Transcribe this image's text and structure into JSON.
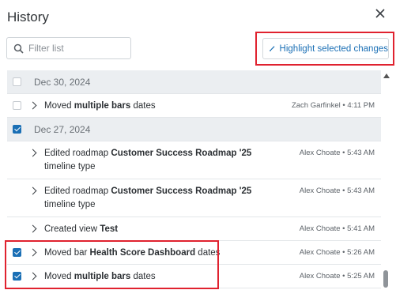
{
  "header": {
    "title": "History"
  },
  "filter": {
    "placeholder": "Filter list"
  },
  "highlight_button": {
    "label": "Highlight selected changes"
  },
  "groups": [
    {
      "date": "Dec 30, 2024",
      "checked": false,
      "items": [
        {
          "text": "Moved ",
          "bold": "multiple bars",
          "suffix": " dates",
          "meta": "Zach Garfinkel • 4:11 PM",
          "checked": false
        }
      ]
    },
    {
      "date": "Dec 27, 2024",
      "checked": true,
      "items": [
        {
          "text": "Edited roadmap ",
          "bold": "Customer Success Roadmap '25",
          "suffix": " timeline type",
          "meta": "Alex Choate • 5:43 AM",
          "checked": false
        },
        {
          "text": "Edited roadmap ",
          "bold": "Customer Success Roadmap '25",
          "suffix": " timeline type",
          "meta": "Alex Choate • 5:43 AM",
          "checked": false
        },
        {
          "text": "Created view ",
          "bold": "Test",
          "suffix": "",
          "meta": "Alex Choate • 5:41 AM",
          "checked": false
        },
        {
          "text": "Moved bar ",
          "bold": "Health Score Dashboard",
          "suffix": " dates",
          "meta": "Alex Choate • 5:26 AM",
          "checked": true
        },
        {
          "text": "Moved ",
          "bold": "multiple bars",
          "suffix": " dates",
          "meta": "Alex Choate • 5:25 AM",
          "checked": true
        }
      ]
    }
  ],
  "colors": {
    "accent": "#1a6fb5",
    "highlight_border": "#e0222f",
    "date_row_bg": "#ebeef1"
  },
  "icons": [
    "close-icon",
    "search-icon",
    "brush-icon",
    "chevron-right-icon",
    "scroll-up-icon"
  ]
}
